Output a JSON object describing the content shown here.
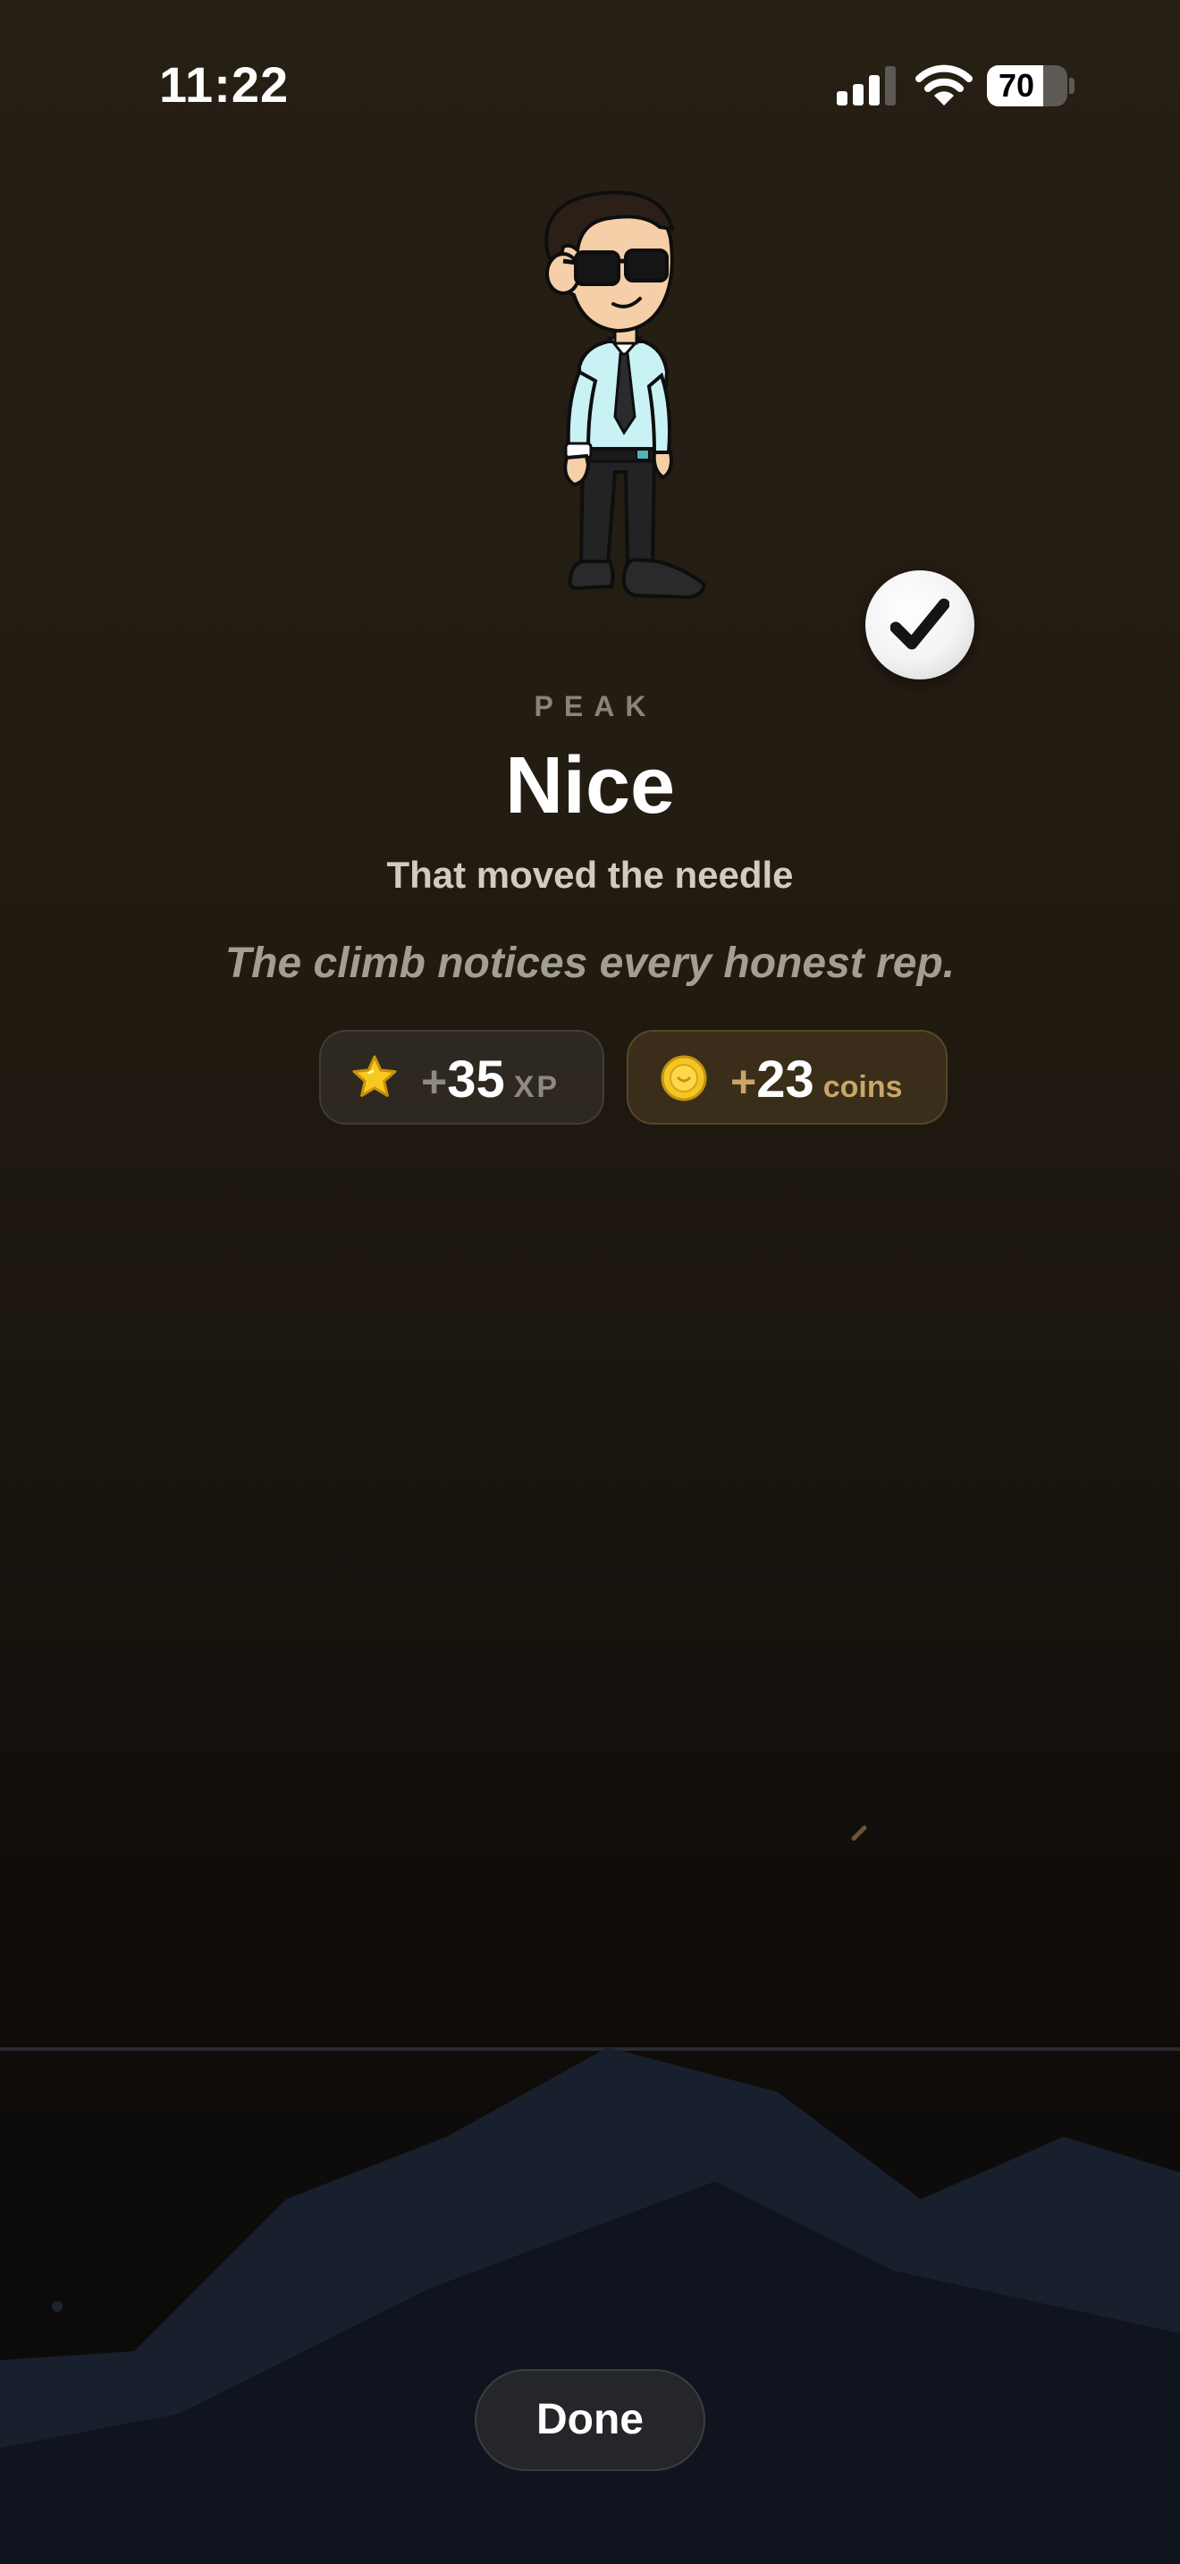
{
  "status_bar": {
    "time": "11:22",
    "battery_percent": "70",
    "icons": [
      "cellular-signal-icon",
      "wifi-icon",
      "battery-icon"
    ]
  },
  "hero": {
    "avatar": "cartoon-businessman-avatar",
    "badge_icon": "checkmark-icon"
  },
  "result": {
    "eyebrow": "PEAK",
    "title": "Nice",
    "subtitle": "That moved the needle",
    "quote": "The climb notices every honest rep."
  },
  "rewards": {
    "xp": {
      "icon": "star-icon",
      "sign": "+",
      "amount": "35",
      "unit": "XP"
    },
    "coins": {
      "icon": "coin-icon",
      "sign": "+",
      "amount": "23",
      "unit": "coins"
    }
  },
  "actions": {
    "done_label": "Done"
  },
  "colors": {
    "background_top": "#261f14",
    "background_bottom": "#0b0a0a",
    "mountain_far": "#18202d",
    "mountain_near": "#0f141e",
    "coin_accent": "#c9a665",
    "star_yellow": "#f7c81f"
  }
}
